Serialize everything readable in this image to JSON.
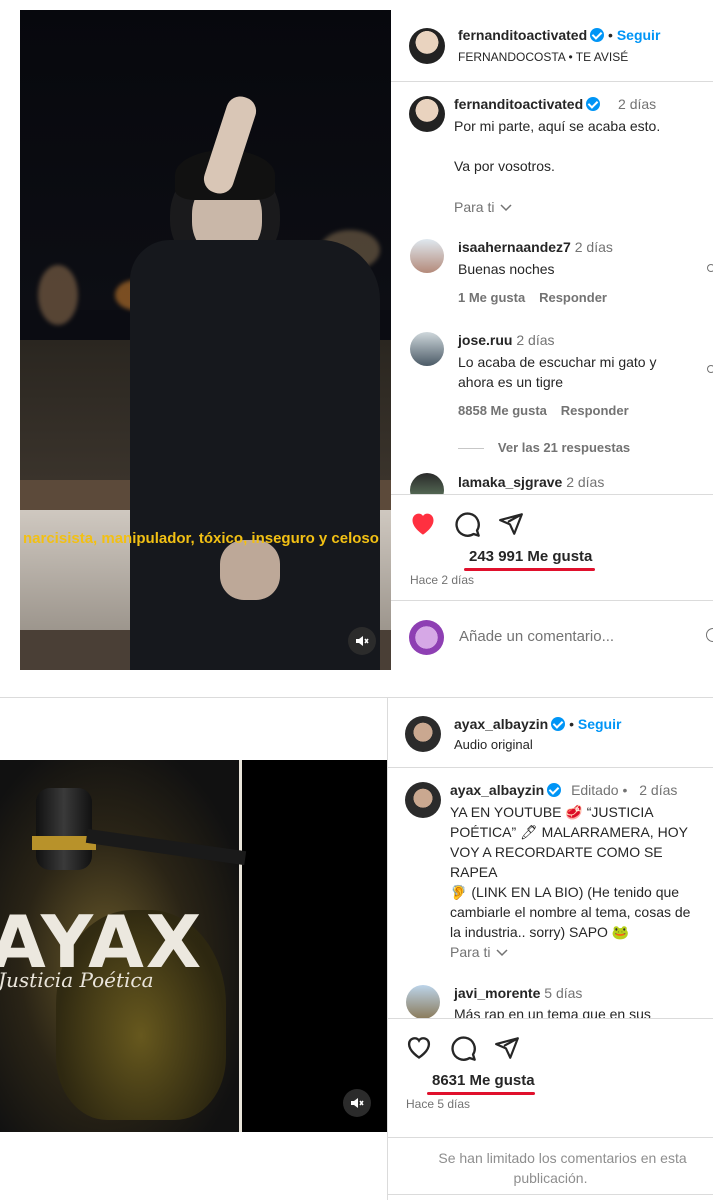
{
  "post1": {
    "header": {
      "username": "fernanditoactivated",
      "follow_label": "Seguir",
      "subtitle": "FERNANDOCOSTA • TE AVISÉ"
    },
    "caption": {
      "username": "fernanditoactivated",
      "time": "2 días",
      "line1": "Por mi parte, aquí se acaba esto.",
      "line2": "Va por vosotros.",
      "para_ti": "Para ti"
    },
    "comments": [
      {
        "username": "isaahernaandez7",
        "time": "2 días",
        "text": "Buenas noches",
        "likes": "1 Me gusta",
        "reply": "Responder"
      },
      {
        "username": "jose.ruu",
        "time": "2 días",
        "text_line1": "Lo acaba de escuchar mi gato y",
        "text_line2": "ahora es un tigre",
        "likes": "8858 Me gusta",
        "reply": "Responder",
        "view_replies": "Ver las 21 respuestas"
      },
      {
        "username": "lamaka_sjgrave",
        "time": "2 días"
      }
    ],
    "video_subtitle": "narcisista, manipulador, tóxico, inseguro y celoso",
    "likes": "243 991 Me gusta",
    "age": "Hace 2 días",
    "comment_placeholder": "Añade un comentario...",
    "liked_color": "#ff3040"
  },
  "post2": {
    "header": {
      "username": "ayax_albayzin",
      "follow_label": "Seguir",
      "subtitle": "Audio original"
    },
    "caption": {
      "username": "ayax_albayzin",
      "edited": "Editado",
      "time": "2 días",
      "lines": [
        "YA EN YOUTUBE 🥩 “JUSTICIA",
        "POÉTICA” 🖊 MALARRAMERA, HOY",
        "VOY A RECORDARTE COMO SE RAPEA",
        "🦻 (LINK EN LA BIO) (He tenido que",
        "cambiarle el nombre al tema, cosas de",
        "la industria.. sorry)  SAPO 🐸"
      ],
      "para_ti": "Para ti"
    },
    "comments": [
      {
        "username": "javi_morente",
        "time": "5 días",
        "text": "Más rap en un tema que en sus"
      }
    ],
    "cover_title": "AYAX",
    "cover_subtitle": "Justicia Poética",
    "likes": "8631 Me gusta",
    "age": "Hace 5 días",
    "limited_line1": "Se han limitado los comentarios en esta",
    "limited_line2": "publicación."
  },
  "icons": {
    "heart": "heart-icon",
    "comment": "comment-icon",
    "share": "share-icon",
    "mute": "mute-icon",
    "chevron": "chevron-down-icon"
  },
  "colors": {
    "accent": "#0095f6",
    "highlight": "#e0102c",
    "subtitle_yellow": "#f2c014"
  }
}
